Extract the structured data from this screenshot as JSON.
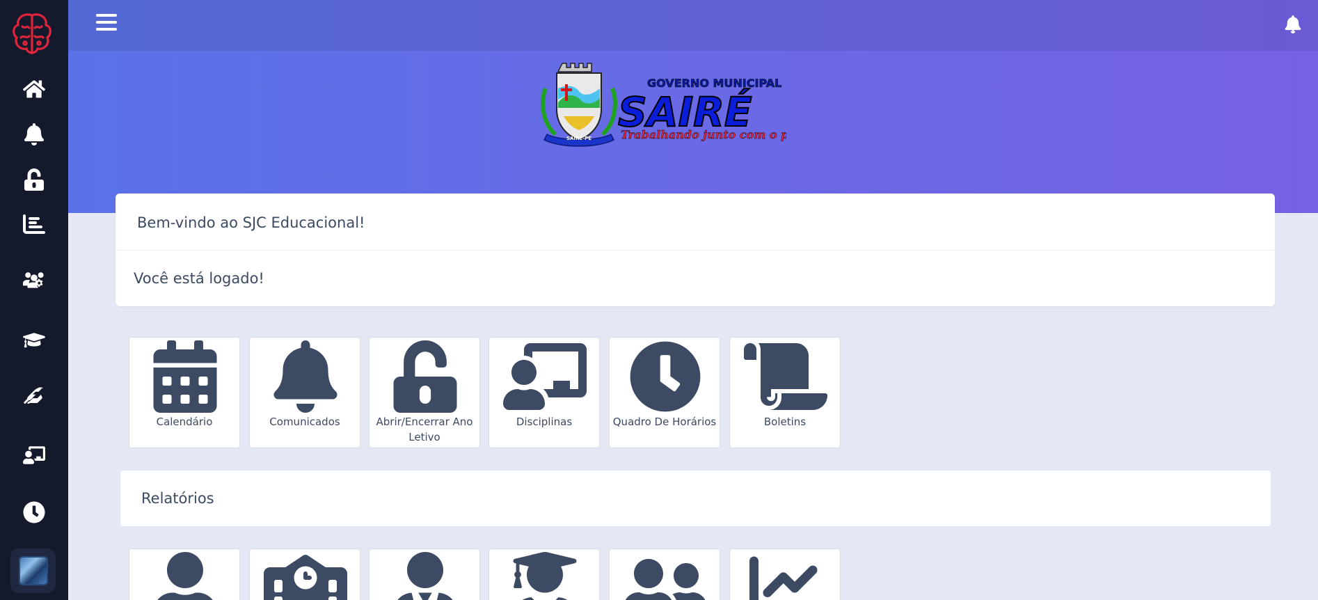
{
  "sidebar": {
    "logo_icon": "brain-logo-icon",
    "items": [
      {
        "icon": "home-icon"
      },
      {
        "icon": "bell-icon"
      },
      {
        "icon": "unlock-icon"
      },
      {
        "icon": "bar-chart-icon"
      },
      {
        "icon": "users-cog-icon"
      },
      {
        "icon": "graduation-cap-icon"
      },
      {
        "icon": "feather-icon"
      },
      {
        "icon": "chalkboard-teacher-icon"
      },
      {
        "icon": "clock-icon"
      }
    ],
    "avatar": "user-avatar"
  },
  "header": {
    "menu_icon": "hamburger-icon",
    "notification_icon": "bell-icon"
  },
  "brand": {
    "line1": "GOVERNO MUNICIPAL",
    "name": "SAIRÉ",
    "slogan": "Trabalhando junto com o povo",
    "crest_text": "SAIRÉ-PE"
  },
  "welcome": {
    "title": "Bem-vindo ao SJC Educacional!",
    "message": "Você está logado!"
  },
  "tiles": [
    {
      "label": "Calendário",
      "icon": "calendar-icon"
    },
    {
      "label": "Comunicados",
      "icon": "bell-icon"
    },
    {
      "label": "Abrir/Encerrar Ano Letivo",
      "icon": "unlock-icon"
    },
    {
      "label": "Disciplinas",
      "icon": "chalkboard-teacher-icon"
    },
    {
      "label": "Quadro De Horários",
      "icon": "clock-icon"
    },
    {
      "label": "Boletins",
      "icon": "scroll-icon"
    }
  ],
  "reports": {
    "title": "Relatórios",
    "tiles": [
      {
        "icon": "user-icon"
      },
      {
        "icon": "school-icon"
      },
      {
        "icon": "user-tie-icon"
      },
      {
        "icon": "user-graduate-icon"
      },
      {
        "icon": "user-friends-icon"
      },
      {
        "icon": "chart-line-icon"
      }
    ]
  },
  "colors": {
    "sidebar": "#141a2c",
    "header_start": "#5468d4",
    "header_end": "#7561e2",
    "background": "#e4e8f5",
    "icon": "#3d4a63",
    "brand_red": "#e0243a"
  }
}
